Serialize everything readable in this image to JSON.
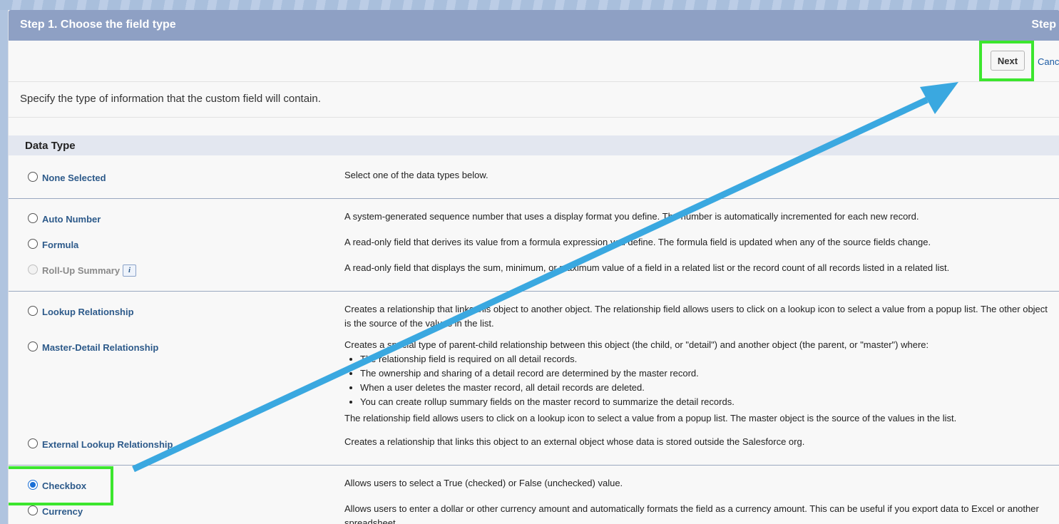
{
  "header": {
    "title": "Step 1. Choose the field type",
    "right_text": "Step"
  },
  "toolbar": {
    "next_label": "Next",
    "cancel_label": "Cance"
  },
  "intro_text": "Specify the type of information that the custom field will contain.",
  "data_type_section": {
    "title": "Data Type",
    "options": [
      {
        "label": "None Selected",
        "description": "Select one of the data types below."
      },
      {
        "label": "Auto Number",
        "description": "A system-generated sequence number that uses a display format you define. The number is automatically incremented for each new record."
      },
      {
        "label": "Formula",
        "description": "A read-only field that derives its value from a formula expression you define. The formula field is updated when any of the source fields change."
      },
      {
        "label": "Roll-Up Summary",
        "description": "A read-only field that displays the sum, minimum, or maximum value of a field in a related list or the record count of all records listed in a related list.",
        "disabled": true,
        "info_icon": "i"
      },
      {
        "label": "Lookup Relationship",
        "description": "Creates a relationship that links this object to another object. The relationship field allows users to click on a lookup icon to select a value from a popup list. The other object is the source of the values in the list."
      },
      {
        "label": "Master-Detail Relationship",
        "description": "Creates a special type of parent-child relationship between this object (the child, or \"detail\") and another object (the parent, or \"master\") where:",
        "bullets": [
          "The relationship field is required on all detail records.",
          "The ownership and sharing of a detail record are determined by the master record.",
          "When a user deletes the master record, all detail records are deleted.",
          "You can create rollup summary fields on the master record to summarize the detail records."
        ],
        "footer": "The relationship field allows users to click on a lookup icon to select a value from a popup list. The master object is the source of the values in the list."
      },
      {
        "label": "External Lookup Relationship",
        "description": "Creates a relationship that links this object to an external object whose data is stored outside the Salesforce org."
      },
      {
        "label": "Checkbox",
        "description": "Allows users to select a True (checked) or False (unchecked) value.",
        "selected": true
      },
      {
        "label": "Currency",
        "description": "Allows users to enter a dollar or other currency amount and automatically formats the field as a currency amount. This can be useful if you export data to Excel or another spreadsheet."
      }
    ]
  },
  "colors": {
    "header_bg": "#8ea0c4",
    "link_blue": "#2d5a8a",
    "highlight_green": "#3ce62e",
    "arrow_blue": "#3aa8e0"
  }
}
